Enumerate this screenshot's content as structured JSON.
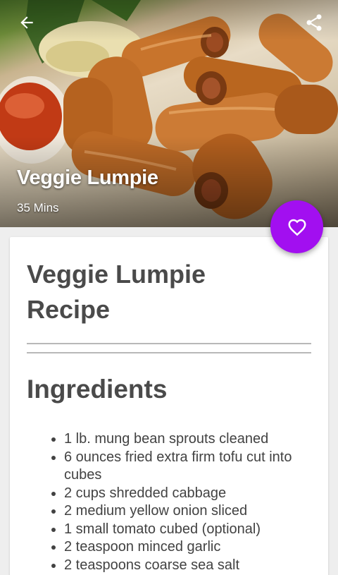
{
  "hero": {
    "title": "Veggie Lumpie",
    "time": "35 Mins"
  },
  "card": {
    "recipe_title": "Veggie Lumpie Recipe",
    "section_title": "Ingredients",
    "ingredients": [
      "1 lb. mung bean sprouts cleaned",
      "6 ounces fried extra firm tofu cut into cubes",
      "2 cups shredded cabbage",
      "2 medium yellow onion sliced",
      "1 small tomato cubed (optional)",
      "2 teaspoon minced garlic",
      "2 teaspoons coarse sea salt"
    ]
  },
  "icons": {
    "back": "arrow-left-icon",
    "share": "share-icon",
    "favorite": "heart-outline-icon"
  },
  "colors": {
    "accent": "#a20ff0",
    "text": "#4a4a4a"
  }
}
